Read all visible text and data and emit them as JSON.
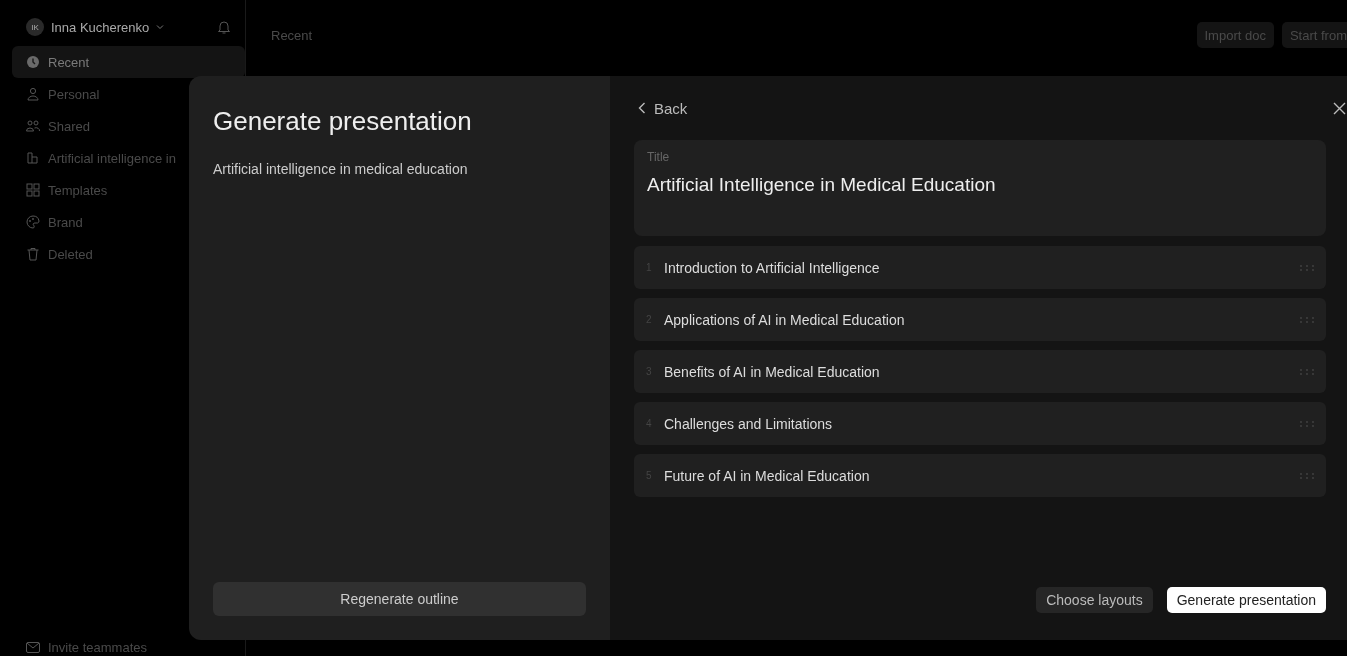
{
  "user": {
    "initials": "IK",
    "name": "Inna Kucherenko"
  },
  "sidebar": {
    "items": [
      {
        "label": "Recent",
        "selected": true
      },
      {
        "label": "Personal",
        "selected": false
      },
      {
        "label": "Shared",
        "selected": false
      },
      {
        "label": "Artificial intelligence in",
        "selected": false
      },
      {
        "label": "Templates",
        "selected": false
      },
      {
        "label": "Brand",
        "selected": false
      },
      {
        "label": "Deleted",
        "selected": false
      }
    ],
    "footer": "Invite teammates"
  },
  "header": {
    "title": "Recent",
    "buttons": [
      "Import doc",
      "Start from"
    ]
  },
  "modal": {
    "heading": "Generate presentation",
    "prompt": "Artificial intelligence in medical education",
    "regenerate": "Regenerate outline",
    "back": "Back",
    "title_field": {
      "label": "Title",
      "value": "Artificial Intelligence in Medical Education"
    },
    "outline": [
      {
        "number": "1",
        "text": "Introduction to Artificial Intelligence"
      },
      {
        "number": "2",
        "text": "Applications of AI in Medical Education"
      },
      {
        "number": "3",
        "text": "Benefits of AI in Medical Education"
      },
      {
        "number": "4",
        "text": "Challenges and Limitations"
      },
      {
        "number": "5",
        "text": "Future of AI in Medical Education"
      }
    ],
    "buttons": [
      {
        "label": "Choose layouts",
        "kind": "secondary"
      },
      {
        "label": "Generate presentation",
        "kind": "primary"
      }
    ]
  }
}
